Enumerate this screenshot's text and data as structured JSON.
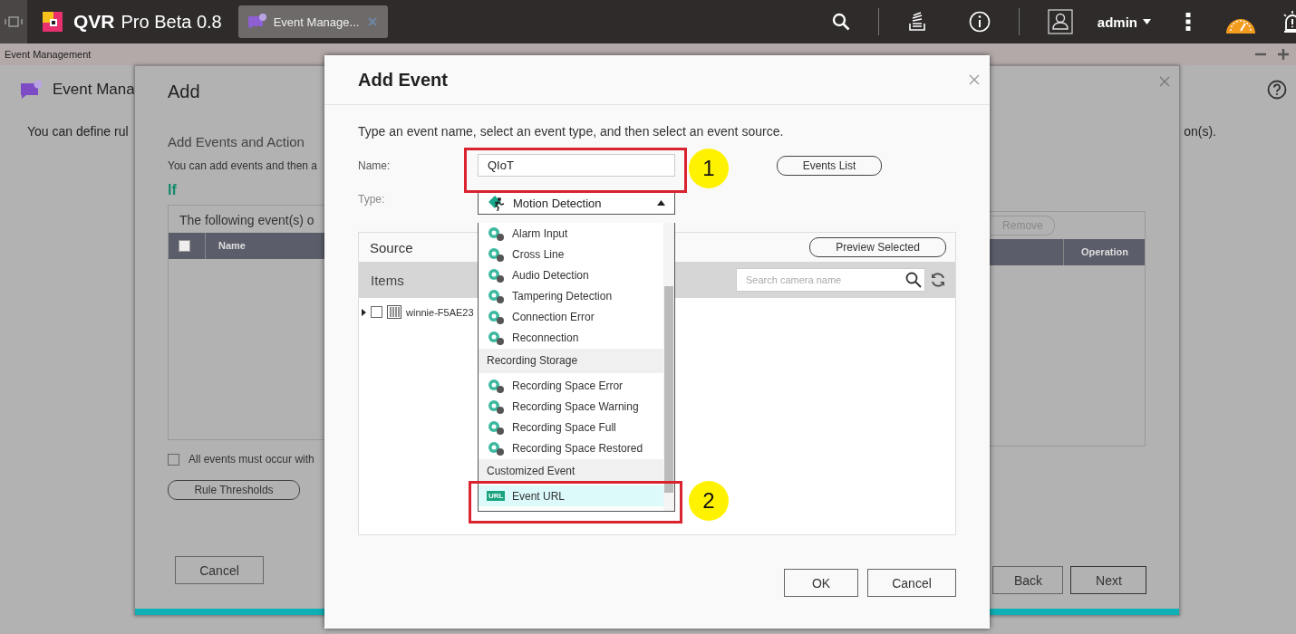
{
  "topbar": {
    "app_name": "QVR",
    "app_version": "Pro Beta 0.8",
    "tab": {
      "label": "Event Manage...",
      "selected": true
    },
    "user": "admin"
  },
  "window": {
    "title": "Event Management"
  },
  "page": {
    "title": "Event Mana",
    "description": "You can define rul",
    "description_end": "on(s)."
  },
  "wizard": {
    "title": "Add",
    "section_title": "Add Events and Action",
    "section_text": "You can add events and then a",
    "if_label": "If",
    "events_table": {
      "caption": "The following event(s) o",
      "remove_button": {
        "label": "Remove",
        "disabled": true
      },
      "columns": [
        "Name",
        "Operation"
      ],
      "select_all": false
    },
    "all_events": {
      "label": "All events must occur with",
      "checked": false
    },
    "thresholds_button": "Rule Thresholds",
    "cancel_button": "Cancel",
    "back_button": "Back",
    "next_button": "Next"
  },
  "dialog": {
    "title": "Add Event",
    "instruction": "Type an event name, select an event type, and then select an event source.",
    "name_label": "Name:",
    "name_value": "QIoT",
    "events_list_button": "Events List",
    "type_label": "Type:",
    "type_value": "Motion Detection",
    "type_expanded": true,
    "type_options": [
      {
        "kind": "option",
        "label": "Alarm Input",
        "selected": false
      },
      {
        "kind": "option",
        "label": "Cross Line",
        "selected": false
      },
      {
        "kind": "option",
        "label": "Audio Detection",
        "selected": false
      },
      {
        "kind": "option",
        "label": "Tampering Detection",
        "selected": false
      },
      {
        "kind": "option",
        "label": "Connection Error",
        "selected": false
      },
      {
        "kind": "option",
        "label": "Reconnection",
        "selected": false
      },
      {
        "kind": "group",
        "label": "Recording Storage"
      },
      {
        "kind": "option",
        "label": "Recording Space Error",
        "selected": false
      },
      {
        "kind": "option",
        "label": "Recording Space Warning",
        "selected": false
      },
      {
        "kind": "option",
        "label": "Recording Space Full",
        "selected": false
      },
      {
        "kind": "option",
        "label": "Recording Space Restored",
        "selected": false
      },
      {
        "kind": "group",
        "label": "Customized Event"
      },
      {
        "kind": "option",
        "label": "Event URL",
        "selected": true,
        "badge": "URL"
      }
    ],
    "source": {
      "title": "Source",
      "preview_button": "Preview Selected",
      "items_label": "Items",
      "search": {
        "placeholder": "Search camera name"
      },
      "tree": [
        {
          "label": "winnie-F5AE23",
          "checked": false,
          "expanded": false
        }
      ]
    },
    "buttons": [
      "OK",
      "Cancel"
    ]
  },
  "callouts": [
    {
      "number": "1"
    },
    {
      "number": "2"
    }
  ]
}
